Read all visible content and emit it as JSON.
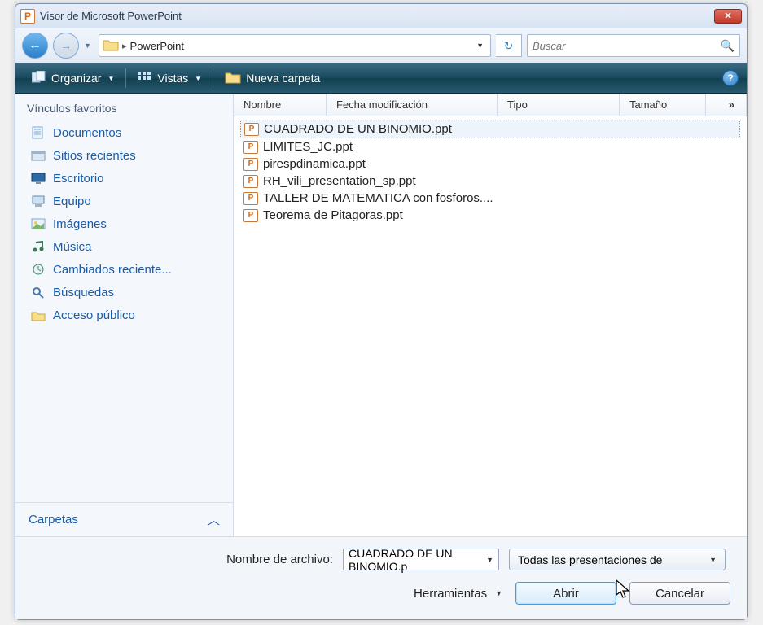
{
  "window": {
    "title": "Visor de Microsoft PowerPoint"
  },
  "nav": {
    "pathSegment": "PowerPoint",
    "search_placeholder": "Buscar"
  },
  "toolbar": {
    "organize": "Organizar",
    "views": "Vistas",
    "new_folder": "Nueva carpeta"
  },
  "sidebar": {
    "header": "Vínculos favoritos",
    "items": [
      {
        "label": "Documentos",
        "icon": "documents-icon"
      },
      {
        "label": "Sitios recientes",
        "icon": "recent-sites-icon"
      },
      {
        "label": "Escritorio",
        "icon": "desktop-icon"
      },
      {
        "label": "Equipo",
        "icon": "computer-icon"
      },
      {
        "label": "Imágenes",
        "icon": "pictures-icon"
      },
      {
        "label": "Música",
        "icon": "music-icon"
      },
      {
        "label": "Cambiados reciente...",
        "icon": "recently-changed-icon"
      },
      {
        "label": "Búsquedas",
        "icon": "searches-icon"
      },
      {
        "label": "Acceso público",
        "icon": "public-icon"
      }
    ],
    "footer": "Carpetas"
  },
  "columns": {
    "name": "Nombre",
    "date": "Fecha modificación",
    "type": "Tipo",
    "size": "Tamaño",
    "more": "»"
  },
  "files": [
    {
      "name": "CUADRADO DE UN BINOMIO.ppt",
      "selected": true
    },
    {
      "name": "LIMITES_JC.ppt",
      "selected": false
    },
    {
      "name": "pirespdinamica.ppt",
      "selected": false
    },
    {
      "name": "RH_vili_presentation_sp.ppt",
      "selected": false
    },
    {
      "name": "TALLER DE MATEMATICA con fosforos....",
      "selected": false
    },
    {
      "name": "Teorema de Pitagoras.ppt",
      "selected": false
    }
  ],
  "footer": {
    "filename_label": "Nombre de archivo:",
    "filename_value": "CUADRADO DE UN BINOMIO.p",
    "filter": "Todas las presentaciones de",
    "tools": "Herramientas",
    "open": "Abrir",
    "cancel": "Cancelar"
  }
}
